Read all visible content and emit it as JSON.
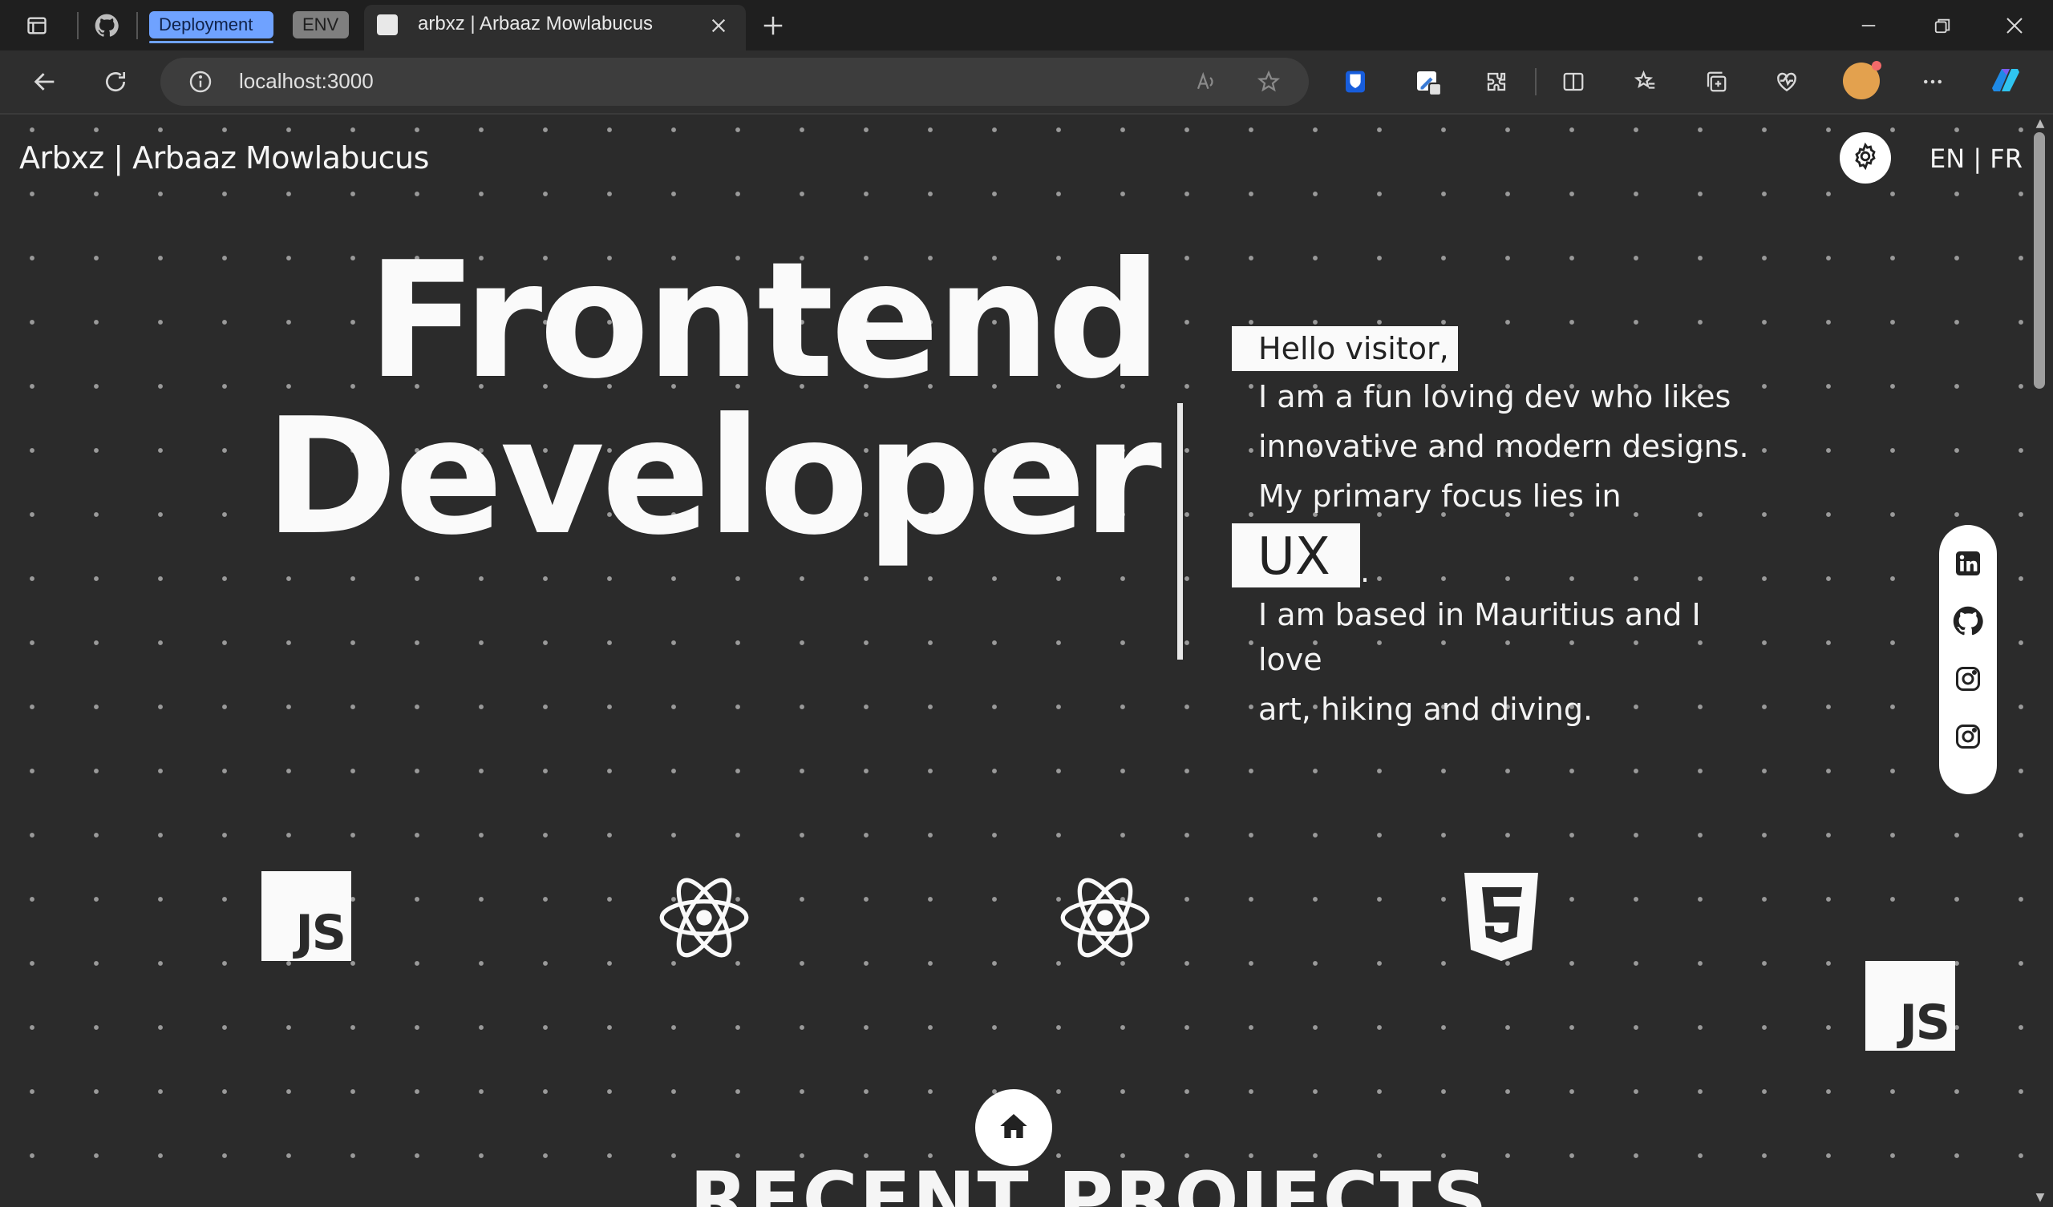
{
  "browser": {
    "tab_groups": [
      "Deployment",
      "ENV"
    ],
    "active_tab_title": "arbxz | Arbaaz Mowlabucus",
    "url": "localhost:3000"
  },
  "header": {
    "logo_text": "Arbxz | Arbaaz Mowlabucus",
    "lang_text": "EN | FR"
  },
  "hero": {
    "title_line1": "Frontend",
    "title_line2": "Developer",
    "greeting": "Hello visitor,",
    "intro_lines": [
      "I am a fun loving dev who likes",
      "innovative and modern designs.",
      "My primary focus lies in"
    ],
    "focus_word": "UX",
    "focus_suffix": ".",
    "bio_lines": [
      "I am based in Mauritius and I",
      "love",
      "art, hiking and diving."
    ]
  },
  "social_icons": [
    "linkedin-icon",
    "github-icon",
    "instagram-icon",
    "instagram-icon"
  ],
  "tech_icons": [
    "javascript-icon",
    "react-icon",
    "react-icon",
    "html5-icon",
    "javascript-icon"
  ],
  "tech_js_label": "JS",
  "sections": {
    "recent_projects": "RECENT PROJECTS"
  },
  "colors": {
    "page_bg": "#2b2b2b",
    "dot": "#9a9a9a",
    "text": "#f5f5f5",
    "tab_group_deployment": "#6fa2ff",
    "tab_group_env": "#7f7f7f"
  }
}
